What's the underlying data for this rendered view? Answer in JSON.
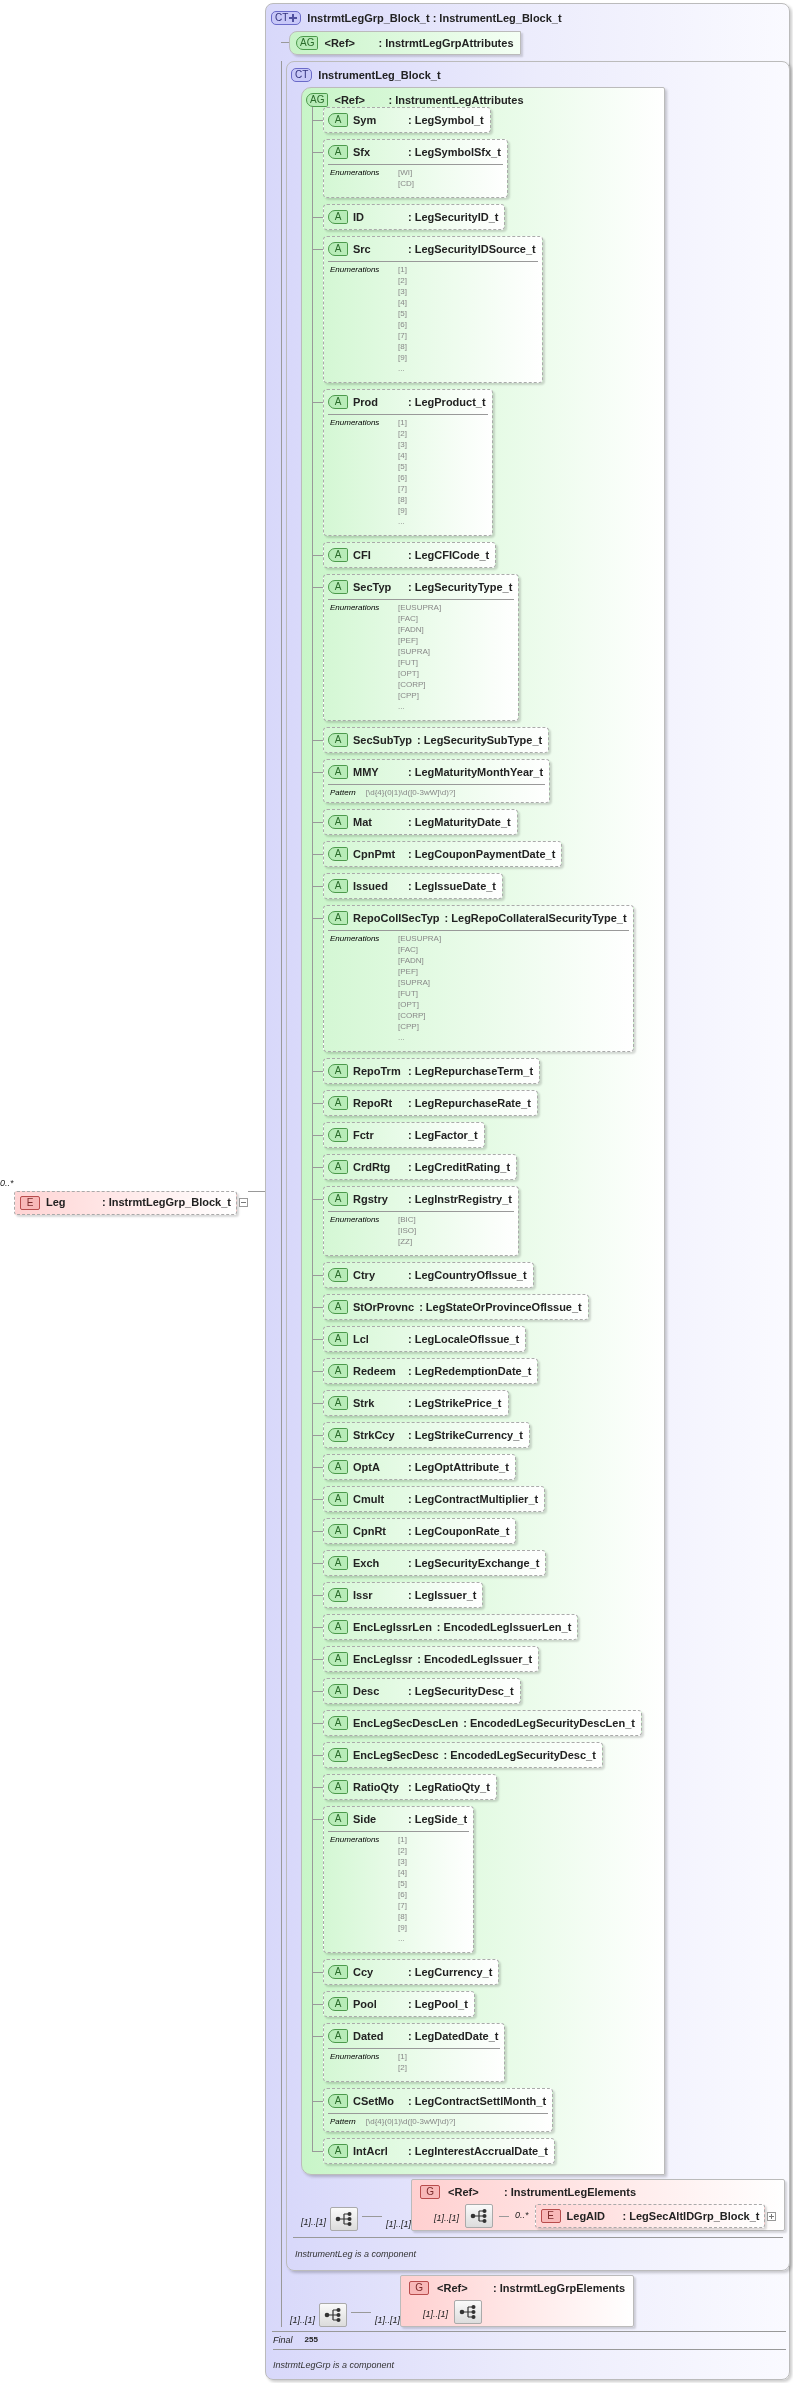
{
  "element": {
    "icon": "E",
    "multiplicity": "0..*",
    "name": "Leg",
    "type": ": InstrmtLegGrp_Block_t"
  },
  "complex_type": {
    "icon": "CT",
    "title": "InstrmtLegGrp_Block_t : InstrumentLeg_Block_t",
    "attribute_group": {
      "icon": "AG",
      "ref": "<Ref>",
      "type": ": InstrmtLegGrpAttributes"
    },
    "inner_type": {
      "icon": "CT",
      "title": "InstrumentLeg_Block_t",
      "attribute_group": {
        "icon": "AG",
        "ref": "<Ref>",
        "type": ": InstrumentLegAttributes",
        "attributes": [
          {
            "icon": "A",
            "name": "Sym",
            "type": ": LegSymbol_t"
          },
          {
            "icon": "A",
            "name": "Sfx",
            "type": ": LegSymbolSfx_t",
            "facet": {
              "kind": "enumeration",
              "label": "Enumerations",
              "values": [
                "[WI]",
                "[CD]"
              ]
            }
          },
          {
            "icon": "A",
            "name": "ID",
            "type": ": LegSecurityID_t"
          },
          {
            "icon": "A",
            "name": "Src",
            "type": ": LegSecurityIDSource_t",
            "facet": {
              "kind": "enumeration",
              "label": "Enumerations",
              "values": [
                "[1]",
                "[2]",
                "[3]",
                "[4]",
                "[5]",
                "[6]",
                "[7]",
                "[8]",
                "[9]",
                "..."
              ]
            }
          },
          {
            "icon": "A",
            "name": "Prod",
            "type": ": LegProduct_t",
            "facet": {
              "kind": "enumeration",
              "label": "Enumerations",
              "values": [
                "[1]",
                "[2]",
                "[3]",
                "[4]",
                "[5]",
                "[6]",
                "[7]",
                "[8]",
                "[9]",
                "..."
              ]
            }
          },
          {
            "icon": "A",
            "name": "CFI",
            "type": ": LegCFICode_t"
          },
          {
            "icon": "A",
            "name": "SecTyp",
            "type": ": LegSecurityType_t",
            "facet": {
              "kind": "enumeration",
              "label": "Enumerations",
              "values": [
                "[EUSUPRA]",
                "[FAC]",
                "[FADN]",
                "[PEF]",
                "[SUPRA]",
                "[FUT]",
                "[OPT]",
                "[CORP]",
                "[CPP]",
                "..."
              ]
            }
          },
          {
            "icon": "A",
            "name": "SecSubTyp",
            "type": ": LegSecuritySubType_t"
          },
          {
            "icon": "A",
            "name": "MMY",
            "type": ": LegMaturityMonthYear_t",
            "facet": {
              "kind": "pattern",
              "label": "Pattern",
              "values": [
                "[\\d{4}(0|1)\\d([0-3wW]\\d)?]"
              ]
            }
          },
          {
            "icon": "A",
            "name": "Mat",
            "type": ": LegMaturityDate_t"
          },
          {
            "icon": "A",
            "name": "CpnPmt",
            "type": ": LegCouponPaymentDate_t"
          },
          {
            "icon": "A",
            "name": "Issued",
            "type": ": LegIssueDate_t"
          },
          {
            "icon": "A",
            "name": "RepoCollSecTyp",
            "type": ": LegRepoCollateralSecurityType_t",
            "facet": {
              "kind": "enumeration",
              "label": "Enumerations",
              "values": [
                "[EUSUPRA]",
                "[FAC]",
                "[FADN]",
                "[PEF]",
                "[SUPRA]",
                "[FUT]",
                "[OPT]",
                "[CORP]",
                "[CPP]",
                "..."
              ]
            }
          },
          {
            "icon": "A",
            "name": "RepoTrm",
            "type": ": LegRepurchaseTerm_t"
          },
          {
            "icon": "A",
            "name": "RepoRt",
            "type": ": LegRepurchaseRate_t"
          },
          {
            "icon": "A",
            "name": "Fctr",
            "type": ": LegFactor_t"
          },
          {
            "icon": "A",
            "name": "CrdRtg",
            "type": ": LegCreditRating_t"
          },
          {
            "icon": "A",
            "name": "Rgstry",
            "type": ": LegInstrRegistry_t",
            "facet": {
              "kind": "enumeration",
              "label": "Enumerations",
              "values": [
                "[BIC]",
                "[ISO]",
                "[ZZ]"
              ]
            }
          },
          {
            "icon": "A",
            "name": "Ctry",
            "type": ": LegCountryOfIssue_t"
          },
          {
            "icon": "A",
            "name": "StOrProvnc",
            "type": ": LegStateOrProvinceOfIssue_t"
          },
          {
            "icon": "A",
            "name": "Lcl",
            "type": ": LegLocaleOfIssue_t"
          },
          {
            "icon": "A",
            "name": "Redeem",
            "type": ": LegRedemptionDate_t"
          },
          {
            "icon": "A",
            "name": "Strk",
            "type": ": LegStrikePrice_t"
          },
          {
            "icon": "A",
            "name": "StrkCcy",
            "type": ": LegStrikeCurrency_t"
          },
          {
            "icon": "A",
            "name": "OptA",
            "type": ": LegOptAttribute_t"
          },
          {
            "icon": "A",
            "name": "Cmult",
            "type": ": LegContractMultiplier_t"
          },
          {
            "icon": "A",
            "name": "CpnRt",
            "type": ": LegCouponRate_t"
          },
          {
            "icon": "A",
            "name": "Exch",
            "type": ": LegSecurityExchange_t"
          },
          {
            "icon": "A",
            "name": "Issr",
            "type": ": LegIssuer_t"
          },
          {
            "icon": "A",
            "name": "EncLegIssrLen",
            "type": ": EncodedLegIssuerLen_t"
          },
          {
            "icon": "A",
            "name": "EncLegIssr",
            "type": ": EncodedLegIssuer_t"
          },
          {
            "icon": "A",
            "name": "Desc",
            "type": ": LegSecurityDesc_t"
          },
          {
            "icon": "A",
            "name": "EncLegSecDescLen",
            "type": ": EncodedLegSecurityDescLen_t"
          },
          {
            "icon": "A",
            "name": "EncLegSecDesc",
            "type": ": EncodedLegSecurityDesc_t"
          },
          {
            "icon": "A",
            "name": "RatioQty",
            "type": ": LegRatioQty_t"
          },
          {
            "icon": "A",
            "name": "Side",
            "type": ": LegSide_t",
            "facet": {
              "kind": "enumeration",
              "label": "Enumerations",
              "values": [
                "[1]",
                "[2]",
                "[3]",
                "[4]",
                "[5]",
                "[6]",
                "[7]",
                "[8]",
                "[9]",
                "..."
              ]
            }
          },
          {
            "icon": "A",
            "name": "Ccy",
            "type": ": LegCurrency_t"
          },
          {
            "icon": "A",
            "name": "Pool",
            "type": ": LegPool_t"
          },
          {
            "icon": "A",
            "name": "Dated",
            "type": ": LegDatedDate_t",
            "facet": {
              "kind": "enumeration",
              "label": "Enumerations",
              "values": [
                "[1]",
                "[2]"
              ]
            }
          },
          {
            "icon": "A",
            "name": "CSetMo",
            "type": ": LegContractSettlMonth_t",
            "facet": {
              "kind": "pattern",
              "label": "Pattern",
              "values": [
                "[\\d{4}(0|1)\\d([0-3wW]\\d)?]"
              ]
            }
          },
          {
            "icon": "A",
            "name": "IntAcrl",
            "type": ": LegInterestAccrualDate_t"
          }
        ]
      },
      "sequence": {
        "multiplicity": "[1]..[1]"
      },
      "group": {
        "multiplicity": "[1]..[1]",
        "icon": "G",
        "ref": "<Ref>",
        "type": ": InstrumentLegElements",
        "sequence_multiplicity": "[1]..[1]",
        "element": {
          "multiplicity": "0..*",
          "icon": "E",
          "name": "LegAID",
          "type": ": LegSecAltIDGrp_Block_t"
        }
      },
      "note": "InstrumentLeg is a component"
    },
    "sequence": {
      "multiplicity": "[1]..[1]"
    },
    "group": {
      "multiplicity": "[1]..[1]",
      "icon": "G",
      "ref": "<Ref>",
      "type": ": InstrmtLegGrpElements",
      "sequence_multiplicity": "[1]..[1]"
    },
    "properties": [
      {
        "label": "Final",
        "value": "255"
      }
    ],
    "note": "InstrmtLegGrp is a component"
  }
}
